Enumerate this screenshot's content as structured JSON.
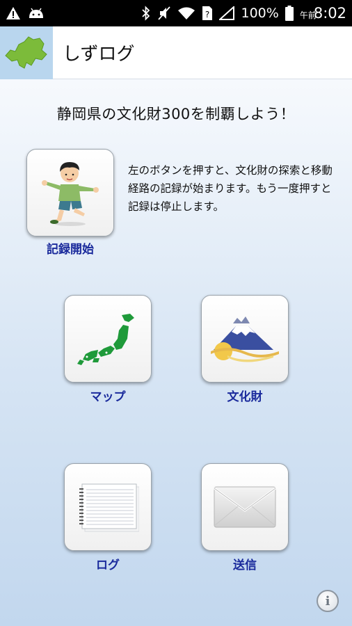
{
  "status_bar": {
    "battery_percent": "100%",
    "time_prefix": "午前",
    "time": "8:02",
    "icons": [
      "warning-icon",
      "android-icon",
      "bluetooth-icon",
      "mute-icon",
      "wifi-icon",
      "sim-icon",
      "signal-icon"
    ]
  },
  "app_bar": {
    "title": "しずログ",
    "logo_icon": "shizuoka-map-logo-icon",
    "logo_color": "#7cbb3a"
  },
  "main": {
    "headline": "静岡県の文化財300を制覇しよう！",
    "description": "左のボタンを押すと、文化財の探索と移動経路の記録が始まります。もう一度押すと記録は停止します。",
    "buttons": {
      "record_start": {
        "label": "記録開始",
        "icon": "boy-running-icon"
      },
      "map": {
        "label": "マップ",
        "icon": "japan-map-icon"
      },
      "cultural_assets": {
        "label": "文化財",
        "icon": "mount-fuji-icon"
      },
      "log": {
        "label": "ログ",
        "icon": "notebook-icon"
      },
      "send": {
        "label": "送信",
        "icon": "envelope-icon"
      }
    },
    "info_button": {
      "icon": "info-icon",
      "label": "i"
    }
  },
  "colors": {
    "label_blue": "#1a2a9c",
    "map_green": "#1f9a3a"
  }
}
